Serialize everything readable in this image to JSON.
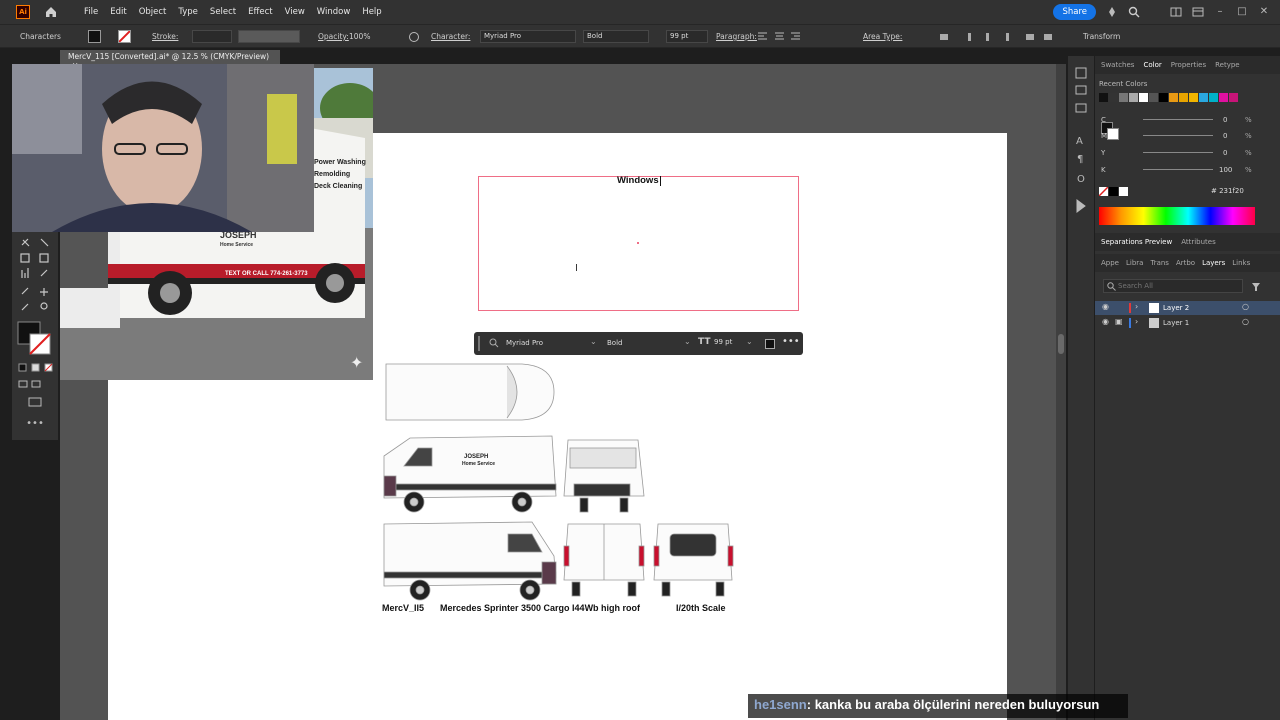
{
  "menubar": {
    "app_logo": "Ai",
    "items": [
      "File",
      "Edit",
      "Object",
      "Type",
      "Select",
      "Effect",
      "View",
      "Window",
      "Help"
    ],
    "share_label": "Share"
  },
  "controlbar": {
    "characters": "Characters",
    "stroke": "Stroke:",
    "opacity_label": "Opacity:",
    "opacity_value": "100%",
    "character_label": "Character:",
    "font": "Myriad Pro",
    "style": "Bold",
    "size": "99 pt",
    "paragraph_label": "Paragraph:",
    "area_type_label": "Area Type:",
    "transform_label": "Transform"
  },
  "document": {
    "tab_title": "MercV_115 [Converted].ai* @ 12.5 % (CMYK/Preview)",
    "typed_text": "Windows"
  },
  "webcam_sign": [
    "Power Washing",
    "Remolding",
    "Deck Cleaning"
  ],
  "van_logo": {
    "line1": "JOSEPH",
    "line2": "Home Service",
    "phone": "TEXT OR CALL 774-261-3773"
  },
  "context_bar": {
    "font": "Myriad Pro",
    "style": "Bold",
    "size": "99 pt"
  },
  "captions": {
    "code": "MercV_II5",
    "model": "Mercedes Sprinter 3500 Cargo I44Wb high roof",
    "scale": "I/20th Scale"
  },
  "panels": {
    "top_tabs": [
      "Swatches",
      "Color",
      "Properties",
      "Retype"
    ],
    "active_top_tab": "Color",
    "recent_colors_label": "Recent Colors",
    "cmyk": [
      {
        "label": "C",
        "value": "0"
      },
      {
        "label": "M",
        "value": "0"
      },
      {
        "label": "Y",
        "value": "0"
      },
      {
        "label": "K",
        "value": "100"
      }
    ],
    "percent": "%",
    "hex_value": "231f20",
    "mid_tabs": [
      "Separations Preview",
      "Attributes"
    ],
    "layer_tabs": [
      "Appe",
      "Libra",
      "Trans",
      "Artbo",
      "Layers",
      "Links"
    ],
    "active_layer_tab": "Layers",
    "search_placeholder": "Search All",
    "layers": [
      "Layer 2",
      "Layer 1"
    ]
  },
  "chat": {
    "user": "he1senn",
    "message": ": kanka bu araba ölçülerini nereden buluyorsun"
  },
  "colors": {
    "selection": "#ef6e86",
    "accent_blue": "#1473e6",
    "van_red": "#c8102e"
  }
}
